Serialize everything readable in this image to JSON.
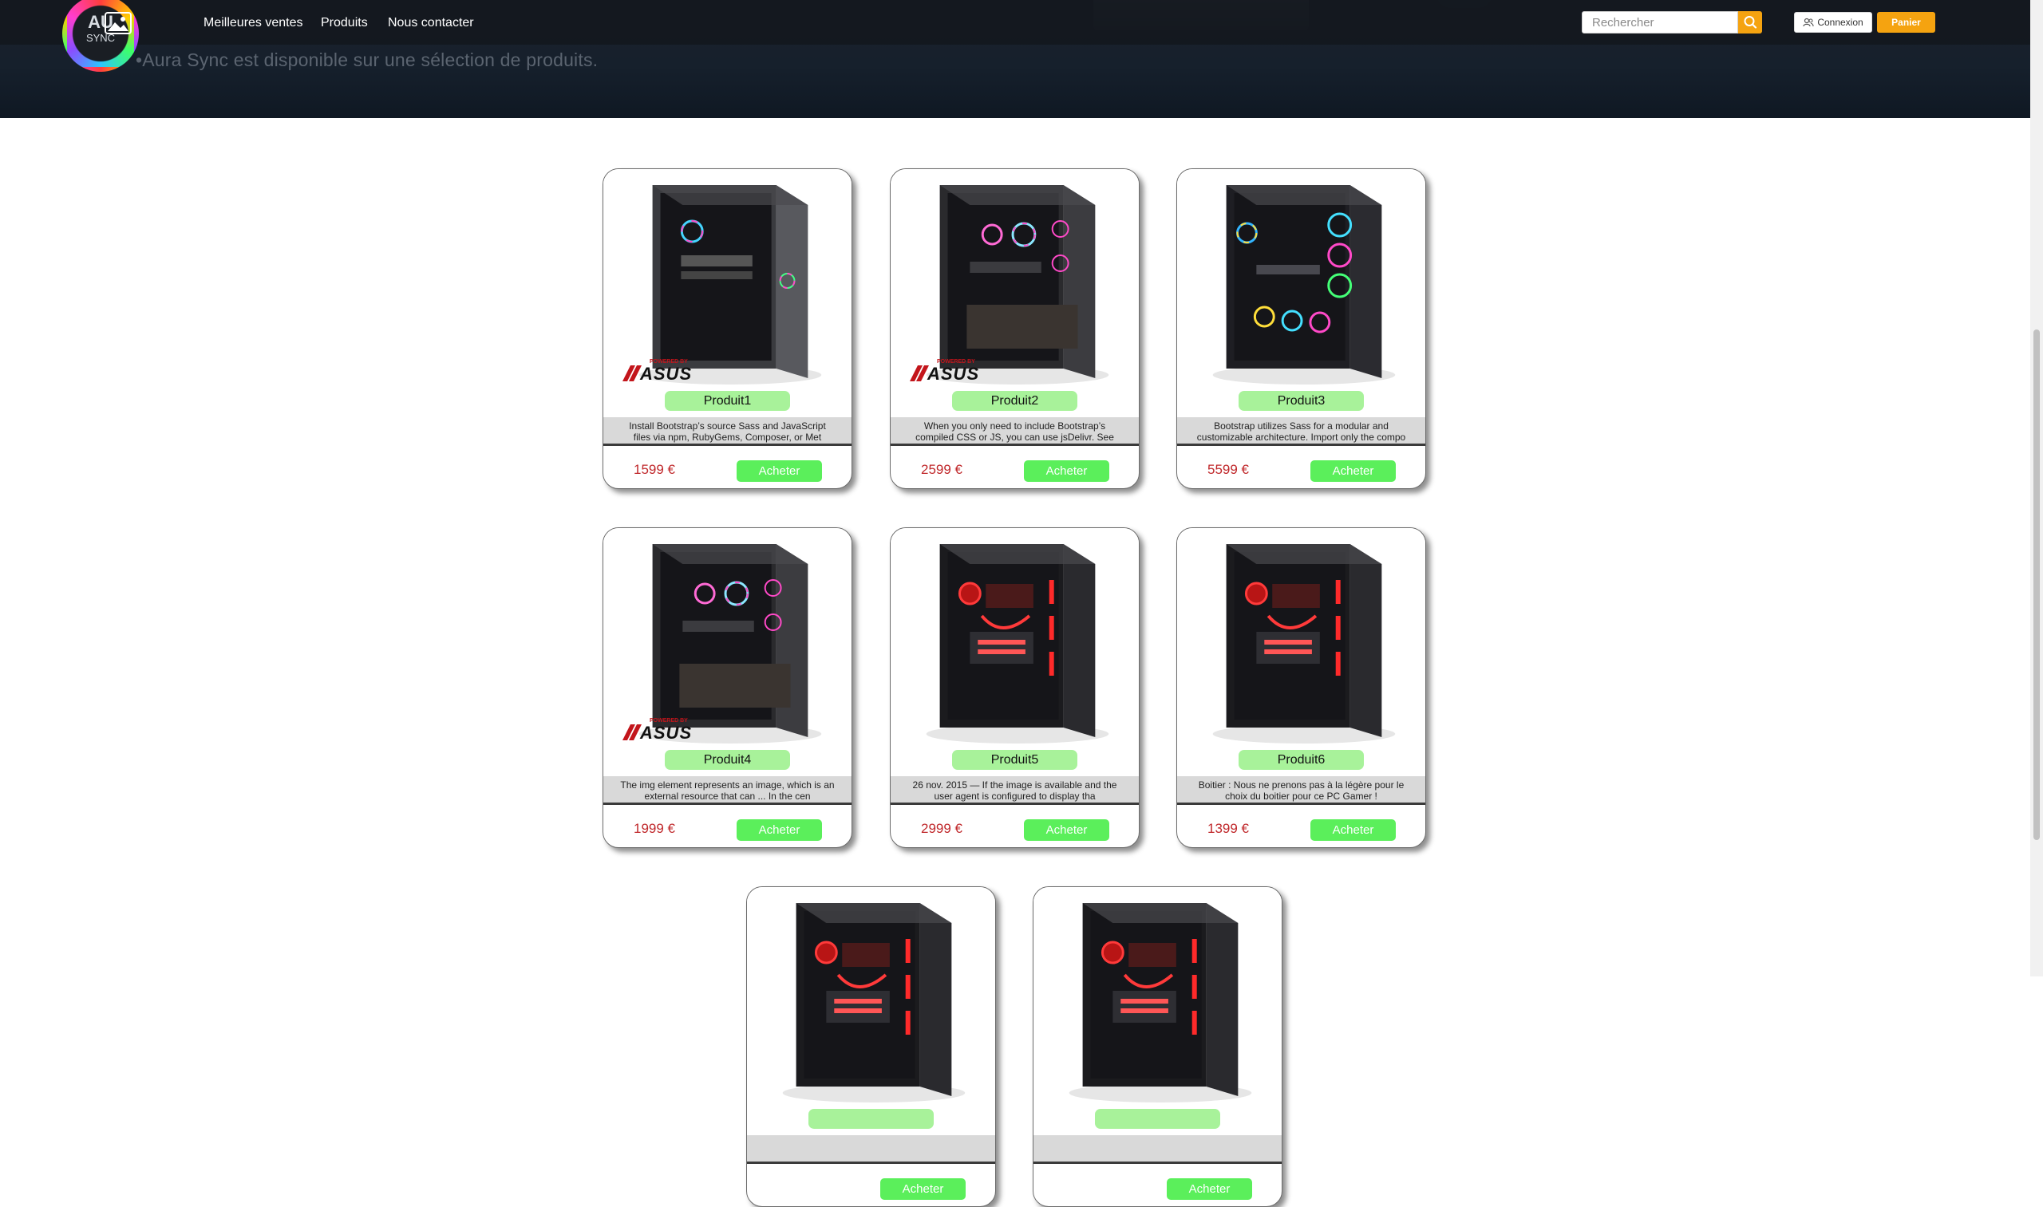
{
  "hero": {
    "tagline": "•Aura Sync est disponible sur une sélection de produits."
  },
  "logo": {
    "line1": "AU",
    "line2": "SYNC",
    "brand": "ASUS"
  },
  "nav": {
    "links": [
      "Meilleures ventes",
      "Produits",
      "Nous contacter"
    ]
  },
  "search": {
    "placeholder": "Rechercher"
  },
  "buttons": {
    "connexion": "Connexion",
    "panier": "Panier"
  },
  "buy_label": "Acheter",
  "powered_by": {
    "line1": "POWERED BY",
    "line2": "ASUS"
  },
  "products": [
    {
      "name": "Produit1",
      "description": "Install Bootstrap’s source Sass and JavaScript files via npm, RubyGems, Composer, or Met",
      "price": "1599 €"
    },
    {
      "name": "Produit2",
      "description": "When you only need to include Bootstrap’s compiled CSS or JS, you can use jsDelivr. See",
      "price": "2599 €"
    },
    {
      "name": "Produit3",
      "description": "Bootstrap utilizes Sass for a modular and customizable architecture. Import only the compo",
      "price": "5599 €"
    },
    {
      "name": "Produit4",
      "description": "The img element represents an image, which is an external resource that can ... In the cen",
      "price": "1999 €"
    },
    {
      "name": "Produit5",
      "description": "26 nov. 2015 — If the image is available and the user agent is configured to display tha",
      "price": "2999 €"
    },
    {
      "name": "Produit6",
      "description": "Boitier : Nous ne prenons pas à la légère pour le choix du boitier pour ce PC Gamer !",
      "price": "1399 €"
    },
    {
      "name": "",
      "description": "",
      "price": ""
    },
    {
      "name": "",
      "description": "",
      "price": ""
    }
  ],
  "colors": {
    "accent_orange": "#f5a310",
    "buy_green": "#5bef5b",
    "badge_green": "#a8f29a",
    "price_red": "#c0282b"
  }
}
